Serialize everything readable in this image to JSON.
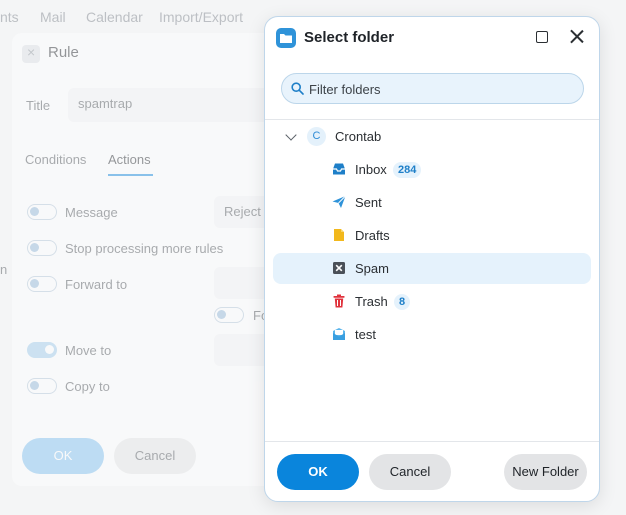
{
  "background": {
    "nav": [
      "nts",
      "Mail",
      "Calendar",
      "Import/Export"
    ],
    "rule_dialog": {
      "title": "Rule",
      "title_label": "Title",
      "title_value": "spamtrap",
      "tabs": [
        "Conditions",
        "Actions"
      ],
      "actions": {
        "message": "Message",
        "message_value": "Reject",
        "stop_processing": "Stop processing more rules",
        "forward_to": "Forward to",
        "forward_sub": "Fo",
        "move_to": "Move to",
        "copy_to": "Copy to"
      },
      "side_label": "n",
      "ok": "OK",
      "cancel": "Cancel"
    }
  },
  "modal": {
    "title": "Select folder",
    "filter_placeholder": "Filter folders",
    "account": {
      "initial": "C",
      "name": "Crontab"
    },
    "folders": [
      {
        "name": "Inbox",
        "icon": "inbox-icon",
        "count": "284"
      },
      {
        "name": "Sent",
        "icon": "sent-icon",
        "count": ""
      },
      {
        "name": "Drafts",
        "icon": "drafts-icon",
        "count": ""
      },
      {
        "name": "Spam",
        "icon": "spam-icon",
        "count": "",
        "selected": true
      },
      {
        "name": "Trash",
        "icon": "trash-icon",
        "count": "8"
      },
      {
        "name": "test",
        "icon": "folder-icon",
        "count": ""
      }
    ],
    "buttons": {
      "ok": "OK",
      "cancel": "Cancel",
      "new_folder": "New Folder"
    }
  },
  "colors": {
    "accent": "#0a85dc",
    "selection": "#e5f2fc",
    "trash": "#e0323c",
    "drafts": "#f2b81c"
  }
}
